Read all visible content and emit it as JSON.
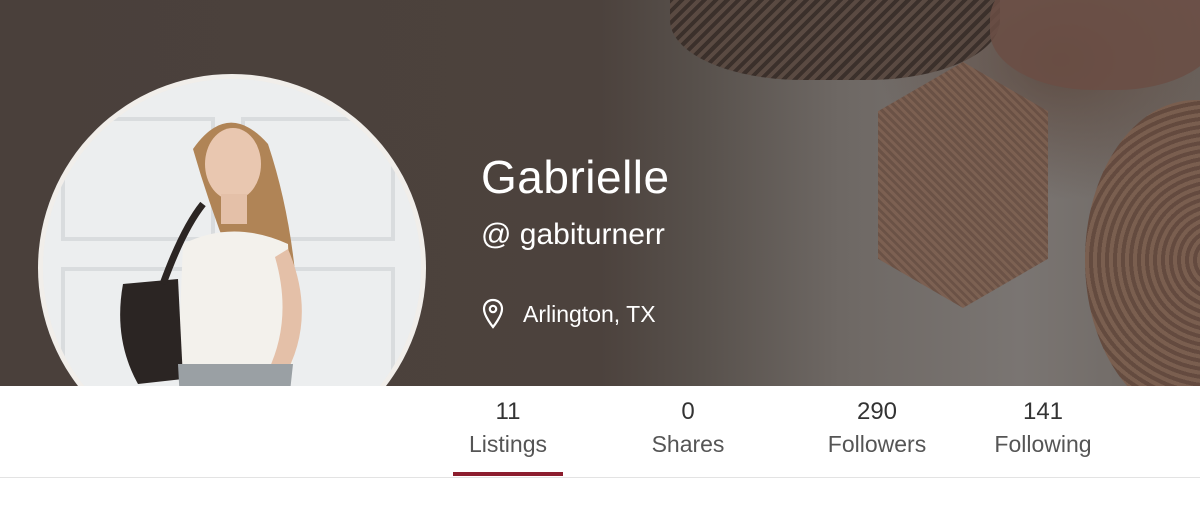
{
  "profile": {
    "name": "Gabrielle",
    "handle": "@ gabiturnerr",
    "location": "Arlington, TX"
  },
  "icons": {
    "location": "map-pin-icon"
  },
  "stats": [
    {
      "value": "11",
      "label": "Listings",
      "active": true
    },
    {
      "value": "0",
      "label": "Shares",
      "active": false
    },
    {
      "value": "290",
      "label": "Followers",
      "active": false
    },
    {
      "value": "141",
      "label": "Following",
      "active": false
    }
  ],
  "colors": {
    "cover": "#4a403b",
    "active_tab": "#8c1d2e",
    "text_on_cover": "#ffffff"
  }
}
